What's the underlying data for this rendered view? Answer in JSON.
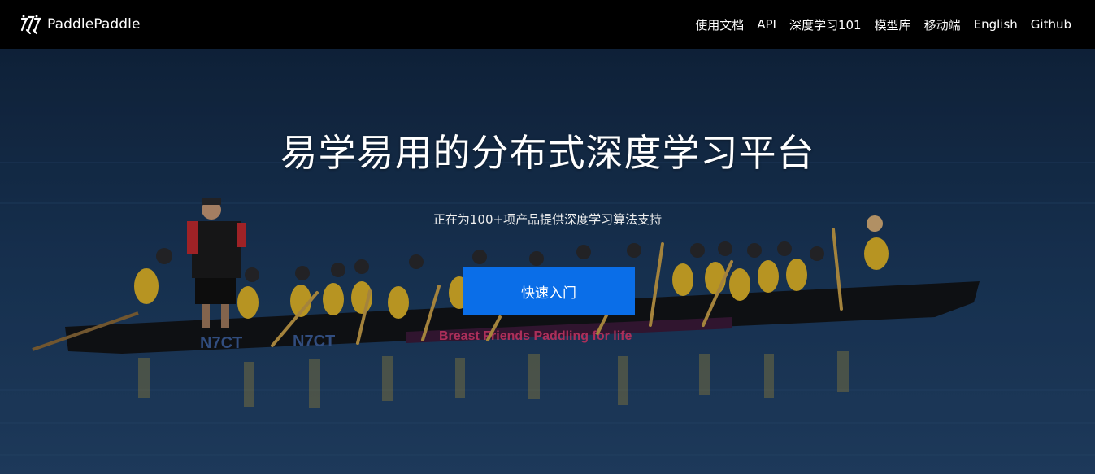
{
  "brand": {
    "name": "PaddlePaddle",
    "logo_icon": "paddlepaddle-logo-icon"
  },
  "nav": {
    "items": [
      {
        "label": "使用文档"
      },
      {
        "label": "API"
      },
      {
        "label": "深度学习101"
      },
      {
        "label": "模型库"
      },
      {
        "label": "移动端"
      },
      {
        "label": "English"
      },
      {
        "label": "Github"
      }
    ]
  },
  "hero": {
    "title": "易学易用的分布式深度学习平台",
    "subtitle": "正在为100+项产品提供深度学习算法支持",
    "cta_label": "快速入门",
    "boat_text_1": "N7CT",
    "boat_text_2": "N7CT",
    "boat_banner": "Breast Friends Paddling for life",
    "background_image": "dragon-boat-team-on-lake"
  },
  "colors": {
    "nav_bg": "#000000",
    "cta_bg": "#0a6ee8",
    "water": "#1d3a5d"
  }
}
